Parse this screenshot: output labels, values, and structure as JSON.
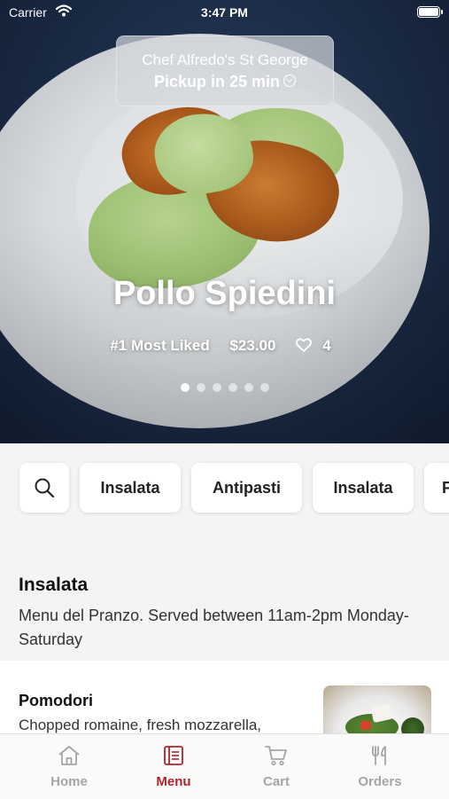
{
  "status_bar": {
    "carrier": "Carrier",
    "time": "3:47 PM"
  },
  "pickup": {
    "restaurant": "Chef Alfredo's St George",
    "time_label": "Pickup in 25 min"
  },
  "featured": {
    "title": "Pollo Spiedini",
    "badge": "#1 Most Liked",
    "price": "$23.00",
    "likes": "4",
    "slide_count": 6,
    "active_slide": 1
  },
  "categories": [
    {
      "label": "Insalata"
    },
    {
      "label": "Antipasti"
    },
    {
      "label": "Insalata"
    },
    {
      "label": "F"
    }
  ],
  "section": {
    "title": "Insalata",
    "description": "Menu del Pranzo. Served between 11am-2pm Monday-Saturday"
  },
  "items": [
    {
      "name": "Pomodori",
      "description": "Chopped romaine, fresh mozzarella,"
    }
  ],
  "tabs": [
    {
      "label": "Home",
      "icon": "home-icon"
    },
    {
      "label": "Menu",
      "icon": "menu-icon"
    },
    {
      "label": "Cart",
      "icon": "cart-icon"
    },
    {
      "label": "Orders",
      "icon": "orders-icon"
    }
  ],
  "colors": {
    "accent": "#b0232a",
    "inactive": "#a5a5a5"
  }
}
